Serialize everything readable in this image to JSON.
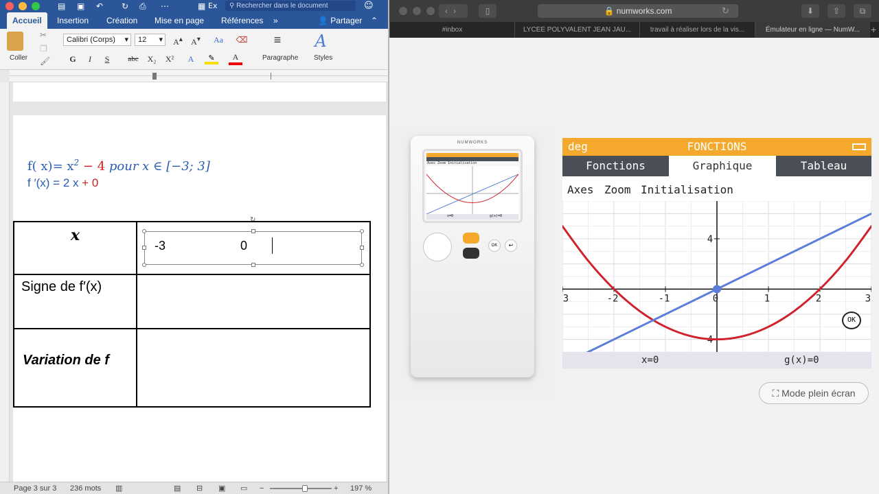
{
  "word": {
    "title_icons": [
      "sidebar-icon",
      "save-icon",
      "undo-icon",
      "redo-icon",
      "print-icon",
      "document-icon"
    ],
    "title_short": "Ex",
    "search_placeholder": "Rechercher dans le document",
    "tabs": [
      "Accueil",
      "Insertion",
      "Création",
      "Mise en page",
      "Références"
    ],
    "tabs_more": "»",
    "share_label": "Partager",
    "ribbon": {
      "paste_label": "Coller",
      "font_name": "Calibri (Corps)",
      "font_size": "12",
      "bold": "G",
      "italic": "I",
      "underline": "S",
      "strike": "abc",
      "subscript": "X₂",
      "superscript": "X²",
      "paragraph_label": "Paragraphe",
      "styles_label": "Styles"
    },
    "doc": {
      "eq1_fx": "f( x)= x",
      "eq1_exp": "2",
      "eq1_minus": " − 4",
      "eq1_rest": " pour x  ∈  [−3; 3]",
      "eq2_fp": "f ′(x) = 2 x",
      "eq2_plus": " + 0",
      "table": {
        "row1_header": "x",
        "x_values": [
          "-3",
          "0"
        ],
        "row2_header": "Signe de  f′(x)",
        "row3_header": "Variation de f"
      }
    },
    "status": {
      "page": "Page 3 sur 3",
      "words": "236 mots",
      "zoom": "197 %"
    }
  },
  "safari": {
    "url": "numworks.com",
    "tabs": [
      "#inbox",
      "LYCEE POLYVALENT JEAN JAU...",
      "travail à réaliser lors de la vis...",
      "Émulateur en ligne — NumW..."
    ],
    "calculator": {
      "brand": "NUMWORKS",
      "mini_menu": "Axes Zoom Initialisation",
      "mini_bottom_left": "x=0",
      "mini_bottom_right": "g(x)=0"
    },
    "emulator": {
      "mode": "deg",
      "app": "FONCTIONS",
      "tabs": [
        "Fonctions",
        "Graphique",
        "Tableau"
      ],
      "active_tab": "Graphique",
      "menu": [
        "Axes",
        "Zoom",
        "Initialisation"
      ],
      "cursor_x_label": "x=0",
      "cursor_y_label": "g(x)=0",
      "ok_label": "OK",
      "fullscreen_label": "Mode plein écran"
    }
  },
  "chart_data": {
    "type": "line",
    "x_tick_labels": [
      "3",
      "-2",
      "-1",
      "0",
      "1",
      "2",
      "3"
    ],
    "y_tick_labels": [
      "4",
      "4"
    ],
    "xlim": [
      -3,
      3
    ],
    "ylim": [
      -5,
      7
    ],
    "grid": true,
    "series": [
      {
        "color": "#d0222c",
        "x": [
          -3,
          -2.5,
          -2,
          -1.5,
          -1,
          -0.5,
          0,
          0.5,
          1,
          1.5,
          2,
          2.5,
          3
        ],
        "y": [
          5,
          2.25,
          0,
          -1.75,
          -3,
          -3.75,
          -4,
          -3.75,
          -3,
          -1.75,
          0,
          2.25,
          5
        ]
      },
      {
        "color": "#5b7fd8",
        "x": [
          -3,
          3
        ],
        "y": [
          -6,
          6
        ]
      }
    ],
    "cursor": {
      "x": 0,
      "y": 0
    }
  }
}
